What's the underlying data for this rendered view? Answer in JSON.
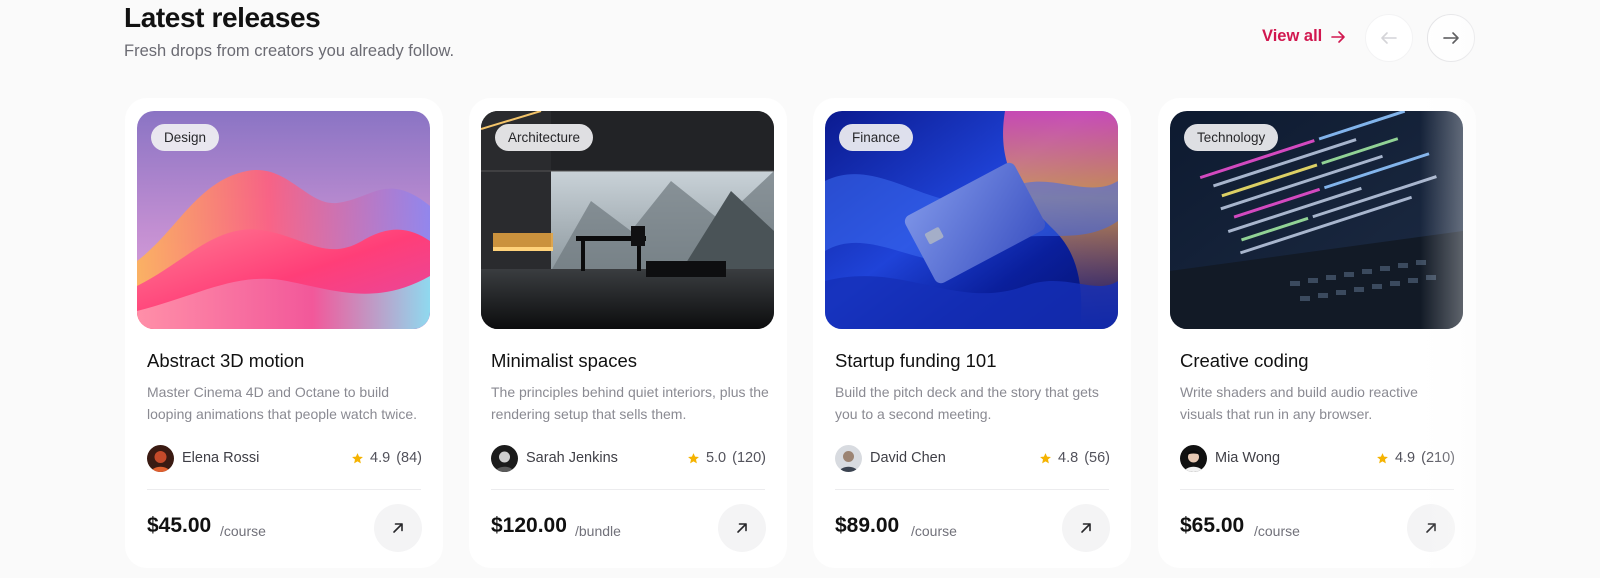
{
  "header": {
    "title": "Latest releases",
    "subtitle": "Fresh drops from creators you already follow.",
    "view_all": "View all",
    "view_all_icon": "arrow-right-icon",
    "prev_icon": "arrow-left-icon",
    "next_icon": "arrow-right-icon"
  },
  "colors": {
    "accent": "#d1174f",
    "star": "#f5b301",
    "background": "#fafafa",
    "card": "#ffffff"
  },
  "cards": [
    {
      "tag": "Design",
      "title": "Abstract 3D motion",
      "description": "Master Cinema 4D and Octane to build looping animations that people watch twice.",
      "author": "Elena Rossi",
      "rating": "4.9",
      "reviews": "(84)",
      "price": "$45.00",
      "unit": "/course",
      "image": "abstract-3d-waves-image"
    },
    {
      "tag": "Architecture",
      "title": "Minimalist spaces",
      "description": "The principles behind quiet interiors, plus the rendering setup that sells them.",
      "author": "Sarah Jenkins",
      "rating": "5.0",
      "reviews": "(120)",
      "price": "$120.00",
      "unit": "/bundle",
      "image": "minimalist-interior-image"
    },
    {
      "tag": "Finance",
      "title": "Startup funding 101",
      "description": "Build the pitch deck and the story that gets you to a second meeting.",
      "author": "David Chen",
      "rating": "4.8",
      "reviews": "(56)",
      "price": "$89.00",
      "unit": "/course",
      "image": "credit-card-image"
    },
    {
      "tag": "Technology",
      "title": "Creative coding",
      "description": "Write shaders and build audio reactive visuals that run in any browser.",
      "author": "Mia Wong",
      "rating": "4.9",
      "reviews": "(210)",
      "price": "$65.00",
      "unit": "/course",
      "image": "code-laptop-image"
    }
  ]
}
